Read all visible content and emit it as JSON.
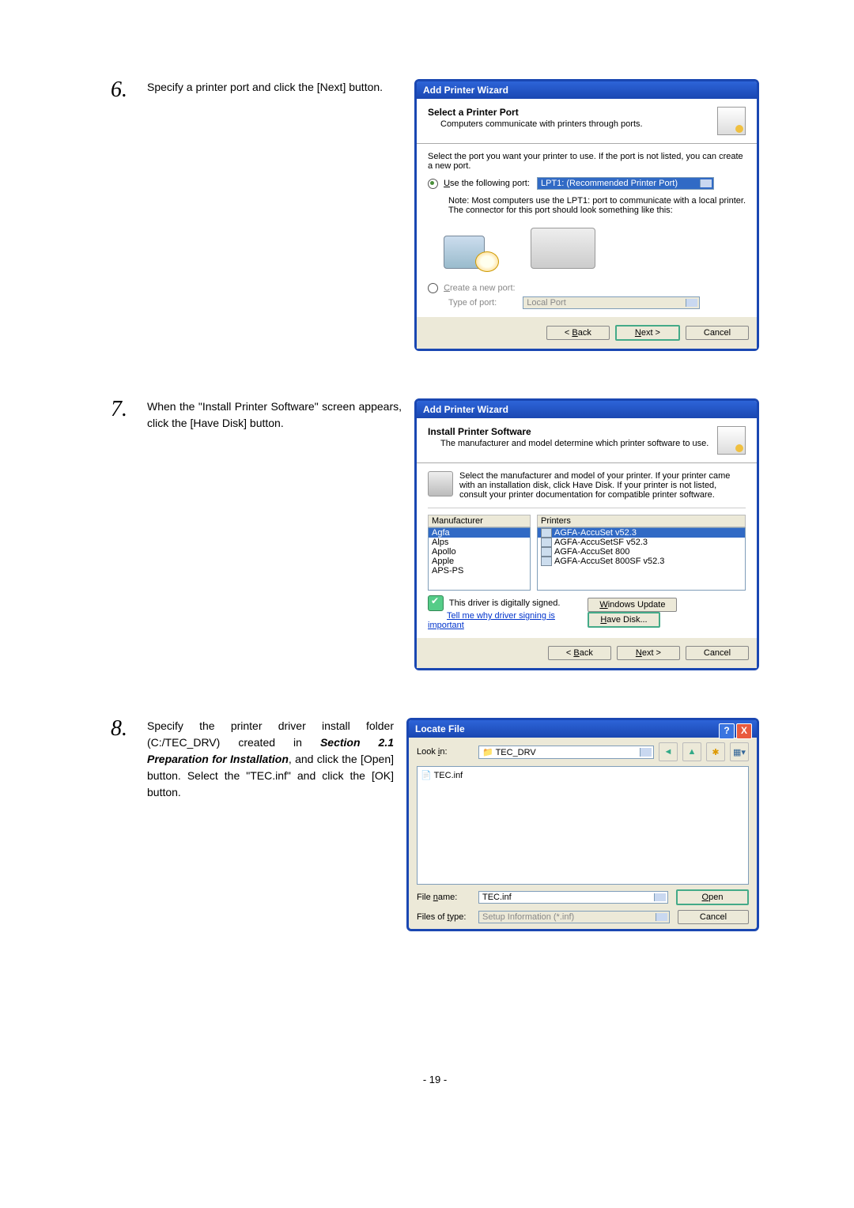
{
  "step6": {
    "num": "6.",
    "text": "Specify a printer port and click the [Next] button."
  },
  "wiz1": {
    "title": "Add Printer Wizard",
    "h": "Select a Printer Port",
    "sub": "Computers communicate with printers through ports.",
    "intro": "Select the port you want your printer to use.  If the port is not listed, you can create a new port.",
    "r_use_pre": "U",
    "r_use": "se the following port:",
    "port_val": "LPT1: (Recommended Printer Port)",
    "note": "Note: Most computers use the LPT1: port to communicate with a local printer. The connector for this port should look something like this:",
    "r_create_pre": "C",
    "r_create": "reate a new port:",
    "type_lbl": "Type of port:",
    "type_val": "Local Port",
    "back_pre": "< ",
    "back_u": "B",
    "back": "ack",
    "next_u": "N",
    "next": "ext >",
    "cancel": "Cancel"
  },
  "step7": {
    "num": "7.",
    "text": "When the \"Install Printer Software\" screen appears, click the [Have Disk] button."
  },
  "wiz2": {
    "title": "Add Printer Wizard",
    "h": "Install Printer Software",
    "sub": "The manufacturer and model determine which printer software to use.",
    "tip": "Select the manufacturer and model of your printer. If your printer came with an installation disk, click Have Disk. If your printer is not listed, consult your printer documentation for compatible printer software.",
    "mfr_head": "Manufacturer",
    "mfrs": [
      "Agfa",
      "Alps",
      "Apollo",
      "Apple",
      "APS-PS"
    ],
    "prn_head": "Printers",
    "prns": [
      "AGFA-AccuSet v52.3",
      "AGFA-AccuSetSF v52.3",
      "AGFA-AccuSet 800",
      "AGFA-AccuSet 800SF v52.3"
    ],
    "signed": "This driver is digitally signed.",
    "tell_pre": "T",
    "tell": "ell me why driver signing is important",
    "wu_pre": "W",
    "wu": "indows Update",
    "hd_pre": "H",
    "hd": "ave Disk...",
    "back_pre": "< ",
    "back_u": "B",
    "back": "ack",
    "next_u": "N",
    "next": "ext >",
    "cancel": "Cancel"
  },
  "step8": {
    "num": "8.",
    "t1": "Specify the printer driver install folder (C:/TEC_DRV) created in ",
    "tbi": "Section 2.1 Preparation for Installation",
    "t2": ", and click the [Open] button.  Select the \"TEC.inf\" and click the [OK] button."
  },
  "lf": {
    "title": "Locate File",
    "look_pre": "Look ",
    "look_u": "i",
    "look_post": "n:",
    "folder": "TEC_DRV",
    "file_item": "TEC.inf",
    "fn_pre": "File ",
    "fn_u": "n",
    "fn_post": "ame:",
    "fn_val": "TEC.inf",
    "ft_pre": "Files of ",
    "ft_u": "t",
    "ft_post": "ype:",
    "ft_val": "Setup Information (*.inf)",
    "open_u": "O",
    "open": "pen",
    "cancel": "Cancel"
  },
  "pgno": "- 19 -"
}
